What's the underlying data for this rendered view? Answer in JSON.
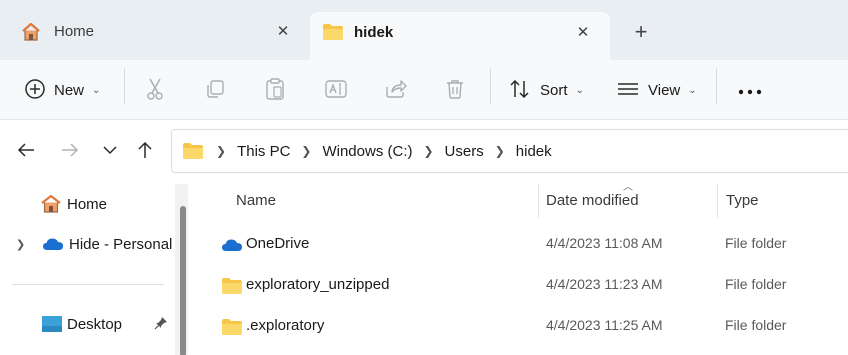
{
  "tabs": [
    {
      "label": "Home",
      "icon": "home-icon",
      "active": false
    },
    {
      "label": "hidek",
      "icon": "folder-icon",
      "active": true
    }
  ],
  "toolbar": {
    "new_label": "New",
    "sort_label": "Sort",
    "view_label": "View",
    "actions": [
      "cut-icon",
      "copy-icon",
      "paste-icon",
      "rename-icon",
      "share-icon",
      "delete-icon",
      "more-icon"
    ]
  },
  "breadcrumb": [
    "This PC",
    "Windows (C:)",
    "Users",
    "hidek"
  ],
  "sidebar": {
    "items": [
      {
        "label": "Home",
        "icon": "home-icon"
      },
      {
        "label": "Hide - Personal",
        "icon": "onedrive-cloud-icon"
      },
      {
        "label": "Desktop",
        "icon": "desktop-icon"
      }
    ]
  },
  "columns": {
    "name": "Name",
    "date": "Date modified",
    "type": "Type"
  },
  "files": [
    {
      "name": "OneDrive",
      "date": "4/4/2023 11:08 AM",
      "type": "File folder",
      "icon": "onedrive-cloud-icon"
    },
    {
      "name": "exploratory_unzipped",
      "date": "4/4/2023 11:23 AM",
      "type": "File folder",
      "icon": "folder-icon"
    },
    {
      "name": ".exploratory",
      "date": "4/4/2023 11:25 AM",
      "type": "File folder",
      "icon": "folder-icon"
    }
  ],
  "colors": {
    "accent": "#0a64c2",
    "folder": "#f6c54a",
    "tabbar": "#e9eef3"
  }
}
